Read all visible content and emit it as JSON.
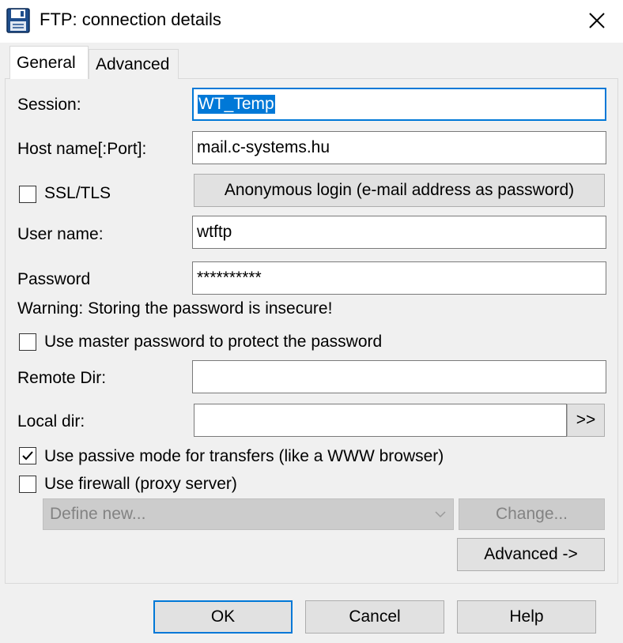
{
  "window": {
    "title": "FTP: connection details",
    "close_glyph": "✕",
    "icon": "floppy-disk-icon"
  },
  "tabs": [
    {
      "label": "General",
      "active": true
    },
    {
      "label": "Advanced",
      "active": false
    }
  ],
  "general": {
    "session_label": "Session:",
    "session_value": "WT_Temp",
    "host_label": "Host name[:Port]:",
    "host_value": "mail.c-systems.hu",
    "ssl_label": "SSL/TLS",
    "ssl_checked": false,
    "anonymous_button": "Anonymous login (e-mail address as password)",
    "user_label": "User name:",
    "user_value": "wtftp",
    "password_label": "Password",
    "password_value": "**********",
    "warning_text": "Warning: Storing the password is insecure!",
    "master_pw_label": "Use master password to protect the password",
    "master_pw_checked": false,
    "remote_dir_label": "Remote Dir:",
    "remote_dir_value": "",
    "local_dir_label": "Local dir:",
    "local_dir_value": "",
    "browse_button": ">>",
    "passive_label": "Use passive mode for transfers (like a WWW browser)",
    "passive_checked": true,
    "firewall_label": "Use firewall (proxy server)",
    "firewall_checked": false,
    "firewall_select_value": "Define new...",
    "change_button": "Change...",
    "advanced_button": "Advanced ->"
  },
  "footer": {
    "ok": "OK",
    "cancel": "Cancel",
    "help": "Help"
  },
  "colors": {
    "accent": "#0078d7",
    "dialog_bg": "#f0f0f0",
    "button_bg": "#e1e1e1",
    "disabled_text": "#838383"
  }
}
